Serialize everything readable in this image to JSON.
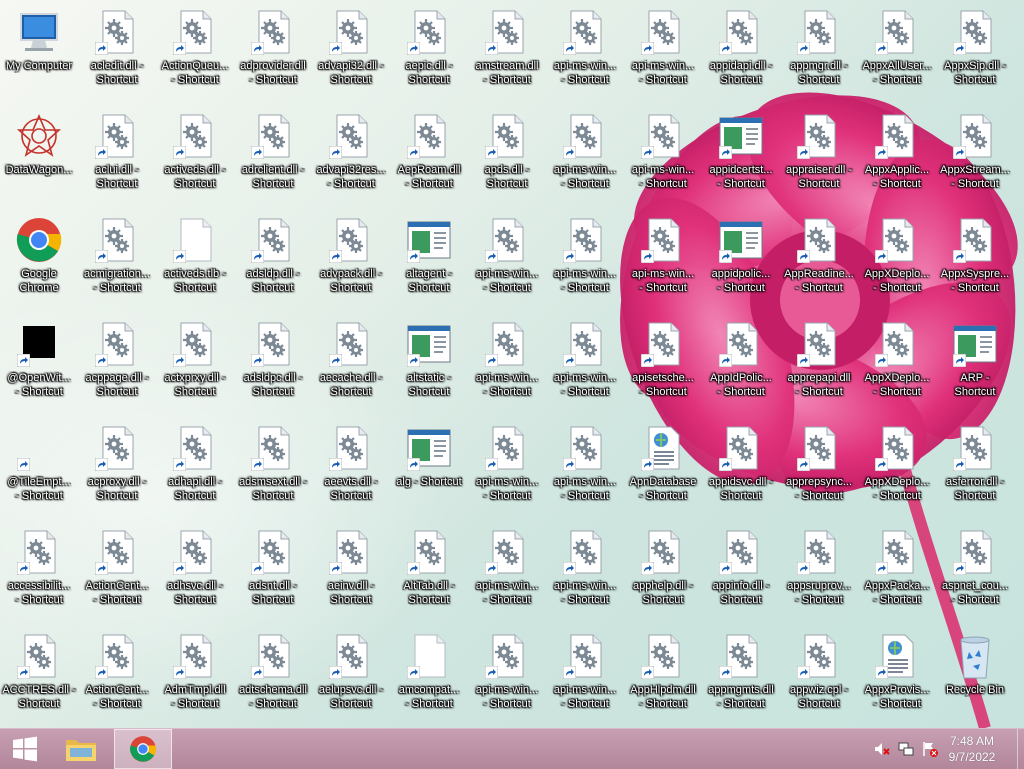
{
  "desktop": {
    "icons": [
      {
        "label": "My Computer",
        "type": "computer"
      },
      {
        "label": "DataWagon...",
        "type": "datawagon"
      },
      {
        "label": "Google Chrome",
        "type": "chrome"
      },
      {
        "label": "@OpenWit...\n- Shortcut",
        "type": "black"
      },
      {
        "label": "@TileEmpt...\n- Shortcut",
        "type": "blank"
      },
      {
        "label": "accessibilit...\n- Shortcut",
        "type": "dll"
      },
      {
        "label": "ACCTRES.dll -\nShortcut",
        "type": "dll"
      },
      {
        "label": "acledit.dll -\nShortcut",
        "type": "dll"
      },
      {
        "label": "aclui.dll -\nShortcut",
        "type": "dll"
      },
      {
        "label": "acmigration...\n- Shortcut",
        "type": "dll"
      },
      {
        "label": "acppage.dll -\nShortcut",
        "type": "dll"
      },
      {
        "label": "acproxy.dll -\nShortcut",
        "type": "dll"
      },
      {
        "label": "ActionCent...\n- Shortcut",
        "type": "dll"
      },
      {
        "label": "ActionCent...\n- Shortcut",
        "type": "dll"
      },
      {
        "label": "ActionQueu...\n- Shortcut",
        "type": "dll"
      },
      {
        "label": "activeds.dll -\nShortcut",
        "type": "dll"
      },
      {
        "label": "activeds.tlb -\nShortcut",
        "type": "file"
      },
      {
        "label": "actxprxy.dll -\nShortcut",
        "type": "dll"
      },
      {
        "label": "adhapi.dll -\nShortcut",
        "type": "dll"
      },
      {
        "label": "adhsvc.dll -\nShortcut",
        "type": "dll"
      },
      {
        "label": "AdmTmpl.dll\n- Shortcut",
        "type": "dll"
      },
      {
        "label": "adprovider.dll\n- Shortcut",
        "type": "dll"
      },
      {
        "label": "adrclient.dll -\nShortcut",
        "type": "dll"
      },
      {
        "label": "adsldp.dll -\nShortcut",
        "type": "dll"
      },
      {
        "label": "adsldpc.dll -\nShortcut",
        "type": "dll"
      },
      {
        "label": "adsmsext.dll -\nShortcut",
        "type": "dll"
      },
      {
        "label": "adsnt.dll -\nShortcut",
        "type": "dll"
      },
      {
        "label": "adtschema.dll\n- Shortcut",
        "type": "dll"
      },
      {
        "label": "advapi32.dll -\nShortcut",
        "type": "dll"
      },
      {
        "label": "advapi32res...\n- Shortcut",
        "type": "dll"
      },
      {
        "label": "advpack.dll -\nShortcut",
        "type": "dll"
      },
      {
        "label": "aecache.dll -\nShortcut",
        "type": "dll"
      },
      {
        "label": "aeevts.dll -\nShortcut",
        "type": "dll"
      },
      {
        "label": "aeinv.dll -\nShortcut",
        "type": "dll"
      },
      {
        "label": "aelupsvc.dll -\nShortcut",
        "type": "dll"
      },
      {
        "label": "aepic.dll -\nShortcut",
        "type": "dll"
      },
      {
        "label": "AepRoam.dll\n- Shortcut",
        "type": "dll"
      },
      {
        "label": "altagent -\nShortcut",
        "type": "exe"
      },
      {
        "label": "altstatic -\nShortcut",
        "type": "exe"
      },
      {
        "label": "alg - Shortcut",
        "type": "exe"
      },
      {
        "label": "AltTab.dll -\nShortcut",
        "type": "dll"
      },
      {
        "label": "amcompat...\n- Shortcut",
        "type": "file"
      },
      {
        "label": "amstream.dll\n- Shortcut",
        "type": "dll"
      },
      {
        "label": "apds.dll -\nShortcut",
        "type": "dll"
      },
      {
        "label": "api-ms-win...\n- Shortcut",
        "type": "dll"
      },
      {
        "label": "api-ms-win...\n- Shortcut",
        "type": "dll"
      },
      {
        "label": "api-ms-win...\n- Shortcut",
        "type": "dll"
      },
      {
        "label": "api-ms-win...\n- Shortcut",
        "type": "dll"
      },
      {
        "label": "api-ms-win...\n- Shortcut",
        "type": "dll"
      },
      {
        "label": "api-ms-win...\n- Shortcut",
        "type": "dll"
      },
      {
        "label": "api-ms-win...\n- Shortcut",
        "type": "dll"
      },
      {
        "label": "api-ms-win...\n- Shortcut",
        "type": "dll"
      },
      {
        "label": "api-ms-win...\n- Shortcut",
        "type": "dll"
      },
      {
        "label": "api-ms-win...\n- Shortcut",
        "type": "dll"
      },
      {
        "label": "api-ms-win...\n- Shortcut",
        "type": "dll"
      },
      {
        "label": "api-ms-win...\n- Shortcut",
        "type": "dll"
      },
      {
        "label": "api-ms-win...\n- Shortcut",
        "type": "dll"
      },
      {
        "label": "api-ms-win...\n- Shortcut",
        "type": "dll"
      },
      {
        "label": "api-ms-win...\n- Shortcut",
        "type": "dll"
      },
      {
        "label": "apisetsche...\n- Shortcut",
        "type": "dll"
      },
      {
        "label": "ApnDatabase\n- Shortcut",
        "type": "xml"
      },
      {
        "label": "apphelp.dll -\nShortcut",
        "type": "dll"
      },
      {
        "label": "AppHlpdm.dll\n- Shortcut",
        "type": "dll"
      },
      {
        "label": "appidapi.dll -\nShortcut",
        "type": "dll"
      },
      {
        "label": "appidcertst...\n- Shortcut",
        "type": "exe"
      },
      {
        "label": "appidpolic...\n- Shortcut",
        "type": "exe"
      },
      {
        "label": "AppIdPolic...\n- Shortcut",
        "type": "dll"
      },
      {
        "label": "appidsvc.dll -\nShortcut",
        "type": "dll"
      },
      {
        "label": "appinfo.dll -\nShortcut",
        "type": "dll"
      },
      {
        "label": "appmgmts.dll\n- Shortcut",
        "type": "dll"
      },
      {
        "label": "appmgr.dll -\nShortcut",
        "type": "dll"
      },
      {
        "label": "appraiser.dll -\nShortcut",
        "type": "dll"
      },
      {
        "label": "AppReadine...\n- Shortcut",
        "type": "dll"
      },
      {
        "label": "apprepapi.dll\n- Shortcut",
        "type": "dll"
      },
      {
        "label": "apprepsync...\n- Shortcut",
        "type": "dll"
      },
      {
        "label": "appsruprov...\n- Shortcut",
        "type": "dll"
      },
      {
        "label": "appwiz.cpl -\nShortcut",
        "type": "dll"
      },
      {
        "label": "AppxAllUser...\n- Shortcut",
        "type": "dll"
      },
      {
        "label": "AppxApplic...\n- Shortcut",
        "type": "dll"
      },
      {
        "label": "AppXDeplo...\n- Shortcut",
        "type": "dll"
      },
      {
        "label": "AppXDeplo...\n- Shortcut",
        "type": "dll"
      },
      {
        "label": "AppXDeplo...\n- Shortcut",
        "type": "dll"
      },
      {
        "label": "AppxPacka...\n- Shortcut",
        "type": "dll"
      },
      {
        "label": "AppxProvis...\n- Shortcut",
        "type": "xml"
      },
      {
        "label": "AppxSip.dll -\nShortcut",
        "type": "dll"
      },
      {
        "label": "AppxStream...\n- Shortcut",
        "type": "dll"
      },
      {
        "label": "AppxSyspre...\n- Shortcut",
        "type": "dll"
      },
      {
        "label": "ARP -\nShortcut",
        "type": "exe"
      },
      {
        "label": "asferror.dll -\nShortcut",
        "type": "dll"
      },
      {
        "label": "aspnet_cou...\n- Shortcut",
        "type": "dll"
      },
      {
        "label": "Recycle Bin",
        "type": "recycle"
      }
    ]
  },
  "taskbar": {
    "start_icon": "windows-start-icon",
    "pinned": [
      {
        "name": "file-explorer",
        "icon": "folder-icon"
      },
      {
        "name": "google-chrome",
        "icon": "chrome-icon"
      }
    ],
    "tray": [
      {
        "name": "volume-muted-icon"
      },
      {
        "name": "network-icon"
      },
      {
        "name": "action-center-flag-icon"
      }
    ],
    "time": "7:48 AM",
    "date": "9/7/2022"
  },
  "colors": {
    "taskbar": "#b88ea2",
    "flower": "#e0307a",
    "background": "#d6ebe4"
  }
}
